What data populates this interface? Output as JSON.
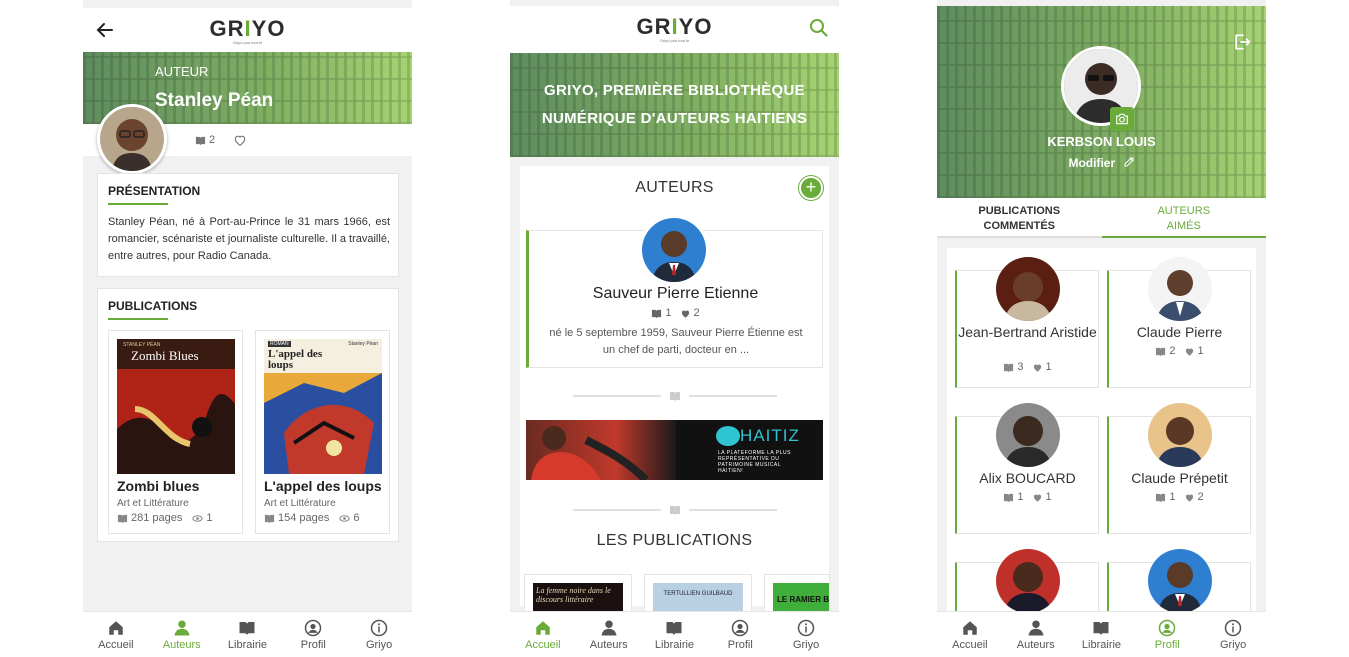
{
  "brand": {
    "logo": "GRIYO",
    "tagline": "Griyo pou tout lè"
  },
  "colors": {
    "accent": "#6aab3a"
  },
  "nav": [
    {
      "id": "home",
      "label": "Accueil",
      "icon": "home-icon"
    },
    {
      "id": "authors",
      "label": "Auteurs",
      "icon": "user-icon"
    },
    {
      "id": "library",
      "label": "Librairie",
      "icon": "book-icon"
    },
    {
      "id": "profile",
      "label": "Profil",
      "icon": "profile-icon"
    },
    {
      "id": "griyo",
      "label": "Griyo",
      "icon": "info-icon"
    }
  ],
  "screen1": {
    "active_nav": "authors",
    "role": "AUTEUR",
    "author_name": "Stanley Péan",
    "books_count": "2",
    "presentation_title": "PRÉSENTATION",
    "presentation_text": "Stanley Péan, né à Port-au-Prince le 31 mars 1966, est romancier, scénariste et journaliste culturelle. Il a travaillé, entre autres, pour Radio Canada.",
    "publications_title": "PUBLICATIONS",
    "books": [
      {
        "title": "Zombi blues",
        "cover_author": "STANLEY PÉAN",
        "cover_title": "Zombi Blues",
        "category": "Art et Littérature",
        "pages": "281 pages",
        "views": "1"
      },
      {
        "title": "L'appel des loups",
        "cover_series": "ROMAN",
        "cover_author": "Stanley Péan",
        "cover_title": "L'appel des loups",
        "category": "Art et Littérature",
        "pages": "154 pages",
        "views": "6"
      }
    ]
  },
  "screen2": {
    "active_nav": "home",
    "banner_line1": "GRIYO, PREMIÈRE BIBLIOTHÈQUE",
    "banner_line2": "NUMÉRIQUE D'AUTEURS HAITIENS",
    "authors_title": "AUTEURS",
    "add_label": "+",
    "featured": {
      "name": "Sauveur Pierre Etienne",
      "books": "1",
      "likes": "2",
      "bio": "né le 5 septembre 1959, Sauveur Pierre Étienne est un chef de parti, docteur en ..."
    },
    "ad": {
      "brand": "HAITIZ",
      "line1": "LA PLATEFORME LA PLUS",
      "line2": "REPRÉSENTATIVE DU",
      "line3": "PATRIMOINE MUSICAL",
      "line4": "HAITIEN!"
    },
    "publications_title": "LES PUBLICATIONS",
    "pub_covers": [
      "La femme noire dans le discours littéraire",
      "TERTULLIEN GUILBAUD",
      "LE RAMIER B"
    ]
  },
  "screen3": {
    "active_nav": "profile",
    "user_name": "KERBSON LOUIS",
    "edit_label": "Modifier",
    "tabs": [
      {
        "line1": "PUBLICATIONS",
        "line2": "COMMENTÉS",
        "active": false
      },
      {
        "line1": "AUTEURS",
        "line2": "AIMÉS",
        "active": true
      }
    ],
    "authors": [
      {
        "name": "Jean-Bertrand Aristide",
        "books": "3",
        "likes": "1"
      },
      {
        "name": "Claude Pierre",
        "books": "2",
        "likes": "1"
      },
      {
        "name": "Alix BOUCARD",
        "books": "1",
        "likes": "1"
      },
      {
        "name": "Claude Prépetit",
        "books": "1",
        "likes": "2"
      }
    ]
  }
}
